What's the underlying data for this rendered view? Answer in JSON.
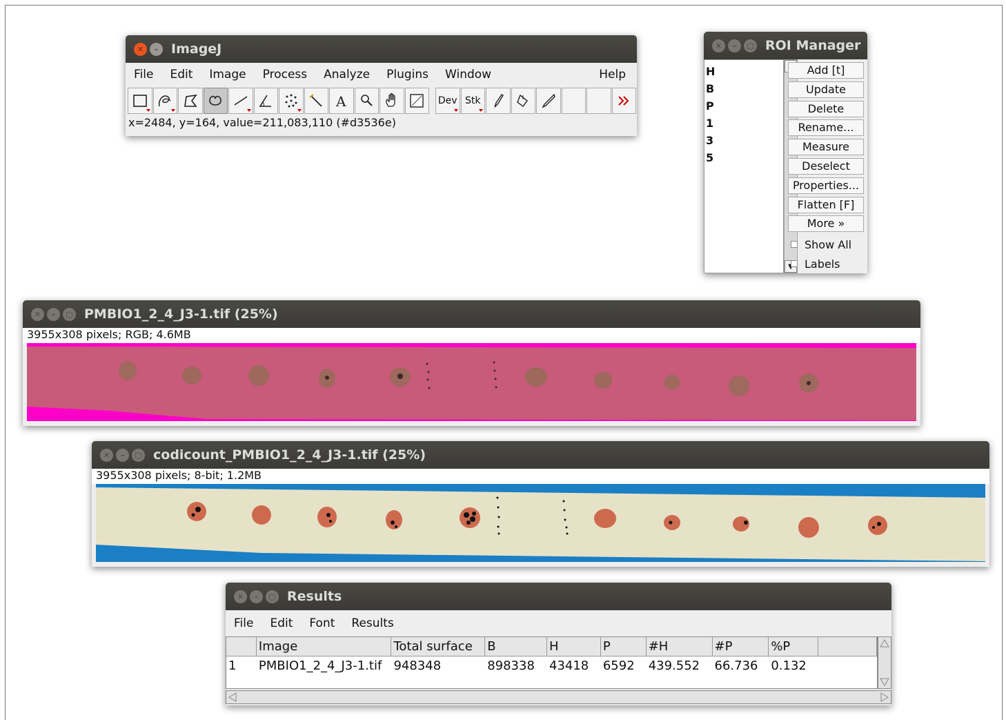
{
  "imagej": {
    "title": "ImageJ",
    "menu": [
      "File",
      "Edit",
      "Image",
      "Process",
      "Analyze",
      "Plugins",
      "Window",
      "Help"
    ],
    "tools": [
      "rectangle-icon",
      "freehand-icon",
      "polygon-icon",
      "oval-icon",
      "line-icon",
      "angle-icon",
      "multipoint-icon",
      "wand-icon",
      "text-icon",
      "magnifier-icon",
      "hand-icon",
      "color-picker-icon",
      "Dev",
      "Stk",
      "brush-icon",
      "flood-fill-icon",
      "pencil-icon",
      "",
      "",
      "more-tools-icon"
    ],
    "dev_label": "Dev",
    "stk_label": "Stk",
    "status": "x=2484, y=164, value=211,083,110 (#d3536e)"
  },
  "roi_manager": {
    "title": "ROI Manager",
    "items": [
      "H",
      "B",
      "P",
      "1",
      "3",
      "5"
    ],
    "buttons": [
      "Add [t]",
      "Update",
      "Delete",
      "Rename...",
      "Measure",
      "Deselect",
      "Properties...",
      "Flatten [F]",
      "More »"
    ],
    "show_all": "Show All",
    "labels": "Labels"
  },
  "image1": {
    "title": "PMBIO1_2_4_J3-1.tif (25%)",
    "info": "3955x308 pixels; RGB; 4.6MB",
    "colors": {
      "background": "#ff00c8",
      "strip": "#c85a7a",
      "blob": "#9a6a5a"
    }
  },
  "image2": {
    "title": "codicount_PMBIO1_2_4_J3-1.tif (25%)",
    "info": "3955x308 pixels; 8-bit; 1.2MB",
    "colors": {
      "background": "#1a7fc4",
      "strip": "#e6e2c8",
      "blob": "#cd6a4e"
    }
  },
  "results": {
    "title": "Results",
    "menu": [
      "File",
      "Edit",
      "Font",
      "Results"
    ],
    "columns": [
      "",
      "Image",
      "Total surface",
      "B",
      "H",
      "P",
      "#H",
      "#P",
      "%P",
      ""
    ],
    "rows": [
      [
        "1",
        "PMBIO1_2_4_J3-1.tif",
        "948348",
        "898338",
        "43418",
        "6592",
        "439.552",
        "66.736",
        "0.132",
        ""
      ]
    ]
  }
}
